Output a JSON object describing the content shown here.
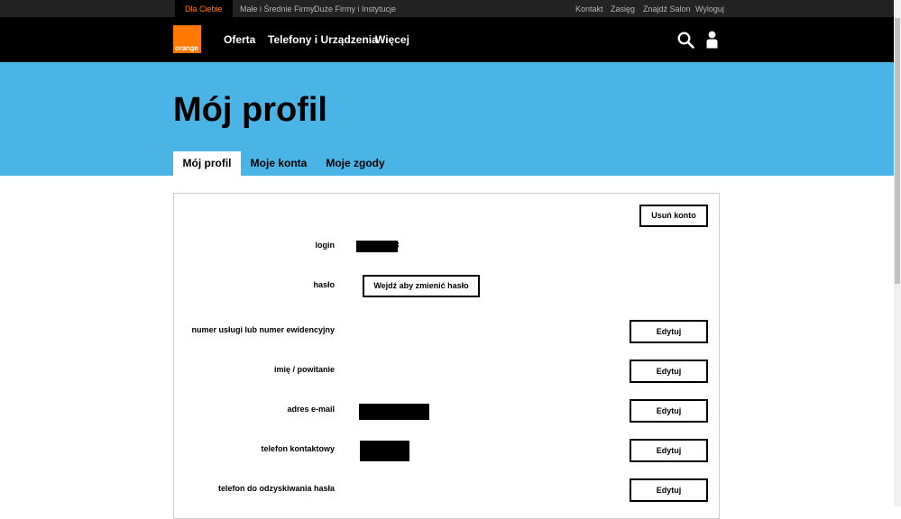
{
  "topbar": {
    "segments": [
      "Dla Ciebie",
      "Małe i Średnie Firmy",
      "Duże Firmy i Instytucje"
    ],
    "links": [
      "Kontakt",
      "Zasięg",
      "Znajdź Salon",
      "Wyloguj"
    ]
  },
  "nav": {
    "logo_text": "orange",
    "items": [
      "Oferta",
      "Telefony i Urządzenia",
      "Więcej"
    ],
    "icons": [
      "search-icon",
      "user-icon"
    ]
  },
  "hero": {
    "title": "Mój profil",
    "tabs": [
      "Mój profil",
      "Moje konta",
      "Moje zgody"
    ],
    "active_tab": "Mój profil"
  },
  "profile": {
    "delete_account_label": "Usuń konto",
    "login_label": "login",
    "login_value_tail": "3",
    "password_label": "hasło",
    "change_password_label": "Wejdź aby zmienić hasło",
    "rows": [
      {
        "label": "numer usługi lub numer ewidencyjny",
        "button": "Edytuj"
      },
      {
        "label": "imię / powitanie",
        "button": "Edytuj"
      },
      {
        "label": "adres e-mail",
        "button": "Edytuj"
      },
      {
        "label": "telefon kontaktowy",
        "button": "Edytuj"
      },
      {
        "label": "telefon do odzyskiwania hasła",
        "button": "Edytuj"
      }
    ]
  },
  "colors": {
    "brand_orange": "#ff7900",
    "hero_blue": "#4bb4e6",
    "nav_black": "#000000",
    "topbar": "#232323"
  }
}
